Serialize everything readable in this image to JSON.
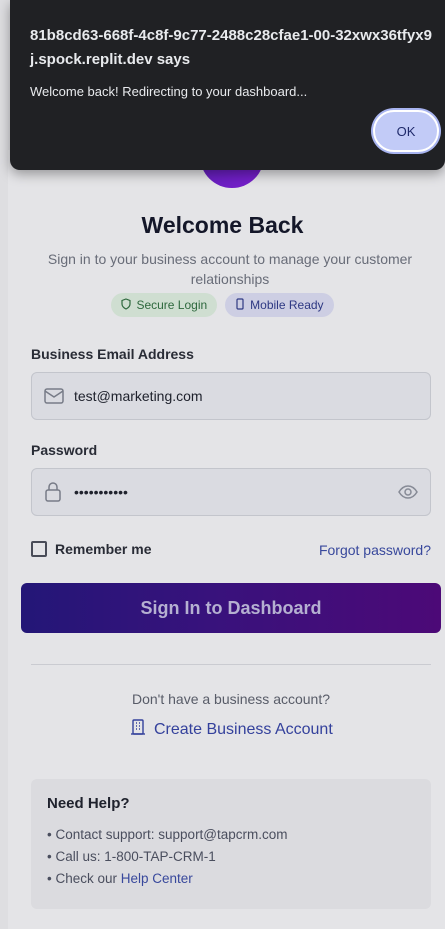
{
  "dialog": {
    "host": "81b8cd63-668f-4c8f-9c77-2488c28cfae1-00-32xwx36tfyx9j.spock.replit.dev says",
    "message": "Welcome back! Redirecting to your dashboard...",
    "ok_label": "OK"
  },
  "header": {
    "title": "Welcome Back",
    "subtitle": "Sign in to your business account to manage your customer relationships"
  },
  "badges": [
    {
      "label": "Secure Login",
      "icon": "shield-icon",
      "color": "#2f6b3f"
    },
    {
      "label": "Mobile Ready",
      "icon": "mobile-icon",
      "color": "#2f3a86"
    }
  ],
  "form": {
    "email_label": "Business Email Address",
    "email_value": "test@marketing.com",
    "password_label": "Password",
    "password_value": "•••••••••••",
    "remember_label": "Remember me",
    "forgot_label": "Forgot password?",
    "submit_label": "Sign In to Dashboard"
  },
  "signup": {
    "prompt": "Don't have a business account?",
    "link_label": "Create Business Account"
  },
  "help": {
    "title": "Need Help?",
    "lines": [
      "• Contact support: support@tapcrm.com",
      "• Call us: 1-800-TAP-CRM-1",
      "• Check our "
    ],
    "help_center_label": "Help Center"
  },
  "colors": {
    "accent": "#3a4aa0",
    "button_gradient_start": "#24177a",
    "button_gradient_end": "#4e0a7a"
  }
}
